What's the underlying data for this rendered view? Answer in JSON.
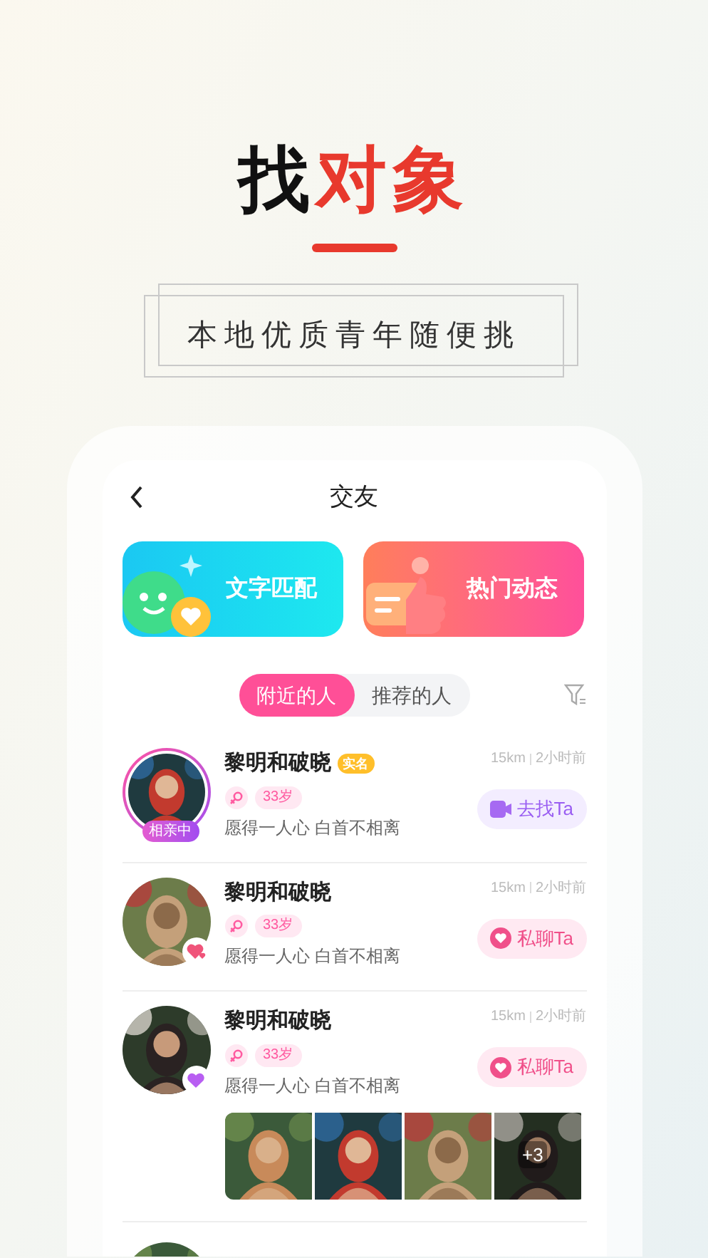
{
  "headline": [
    {
      "text": "找",
      "accent": false
    },
    {
      "text": "对象",
      "accent": true
    }
  ],
  "tagline": "本地优质青年随便挑",
  "screen": {
    "title": "交友",
    "feature_cards": [
      {
        "kind": "match",
        "label": "文字匹配"
      },
      {
        "kind": "moments",
        "label": "热门动态"
      }
    ],
    "tabs": [
      {
        "label": "附近的人",
        "selected": true
      },
      {
        "label": "推荐的人",
        "selected": false
      }
    ],
    "people": [
      {
        "name": "黎明和破晓",
        "verified": "实名",
        "age": "33岁",
        "bio": "愿得一人心 白首不相离",
        "distance": "15km",
        "time": "2小时前",
        "badge": {
          "kind": "status",
          "label": "相亲中"
        },
        "action": {
          "kind": "video",
          "label": "去找Ta"
        }
      },
      {
        "name": "黎明和破晓",
        "age": "33岁",
        "bio": "愿得一人心 白首不相离",
        "distance": "15km",
        "time": "2小时前",
        "badge": {
          "kind": "hearts"
        },
        "action": {
          "kind": "chat",
          "label": "私聊Ta"
        }
      },
      {
        "name": "黎明和破晓",
        "age": "33岁",
        "bio": "愿得一人心 白首不相离",
        "distance": "15km",
        "time": "2小时前",
        "badge": {
          "kind": "heart"
        },
        "action": {
          "kind": "chat",
          "label": "私聊Ta"
        },
        "photos": [
          {
            "kind": "picture"
          },
          {
            "kind": "picture"
          },
          {
            "kind": "picture"
          },
          {
            "kind": "picture",
            "more": "+3"
          }
        ]
      }
    ]
  }
}
